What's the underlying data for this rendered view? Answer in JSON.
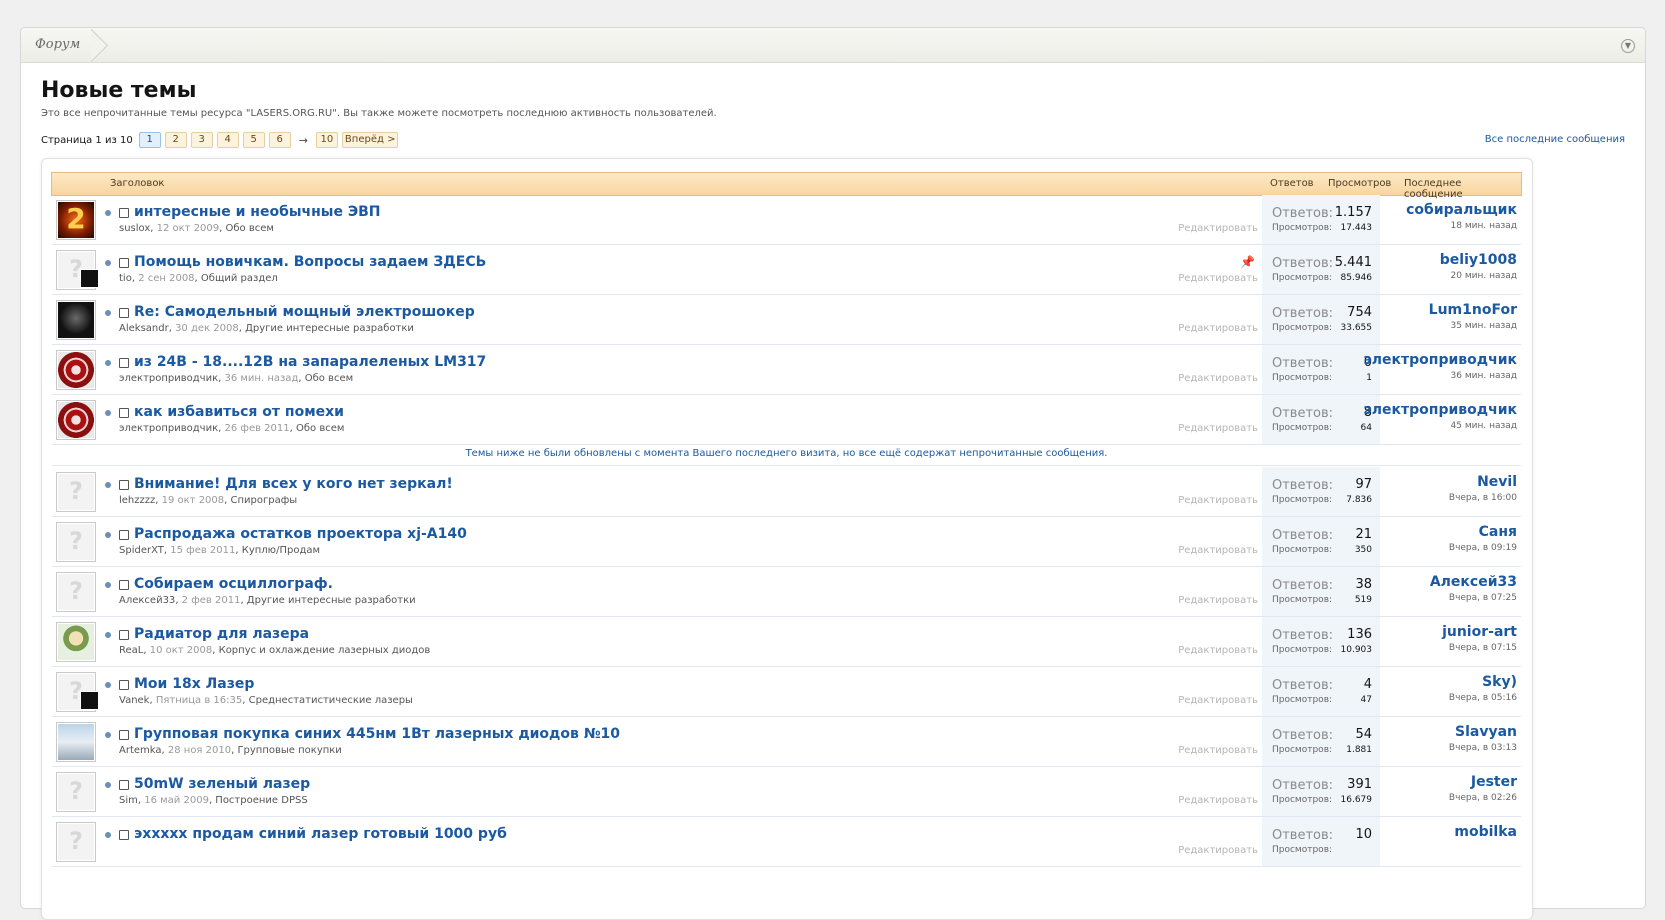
{
  "breadcrumb": {
    "root": "Форум"
  },
  "page": {
    "title": "Новые темы",
    "description": "Это все непрочитанные темы ресурса \"LASERS.ORG.RU\". Вы также можете посмотреть последнюю активность пользователей."
  },
  "pager": {
    "label": "Страница 1 из 10",
    "pages": [
      "1",
      "2",
      "3",
      "4",
      "5",
      "6"
    ],
    "arrow": "→",
    "last": "10",
    "next": "Вперёд >"
  },
  "all_recent": "Все последние сообщения",
  "table_head": {
    "title": "Заголовок",
    "replies": "Ответов",
    "views": "Просмотров",
    "last": "Последнее сообщение"
  },
  "labels": {
    "replies": "Ответов:",
    "views": "Просмотров:",
    "edit": "Редактировать",
    "pin": "📌"
  },
  "notice": "Темы ниже не были обновлены с момента Вашего последнего визита, но все ещё содержат непрочитанные сообщения.",
  "threads": [
    {
      "title": "интересные и необычные ЭВП",
      "author": "suslox",
      "date": "12 окт 2009",
      "forum": "Обо всем",
      "replies": "1.157",
      "views": "17.443",
      "last_user": "собиральщик",
      "last_time": "18 мин. назад",
      "avatar": "nixie"
    },
    {
      "title": "Помощь новичкам. Вопросы задаем ЗДЕСЬ",
      "author": "tio",
      "date": "2 сен 2008",
      "forum": "Общий раздел",
      "replies": "5.441",
      "views": "85.946",
      "last_user": "beliy1008",
      "last_time": "20 мин. назад",
      "avatar": "blank",
      "sticky": true,
      "mini": true
    },
    {
      "title": "Re: Самодельный мощный электрошокер",
      "author": "Aleksandr",
      "date": "30 дек 2008",
      "forum": "Другие интересные разработки",
      "replies": "754",
      "views": "33.655",
      "last_user": "Lum1noFor",
      "last_time": "35 мин. назад",
      "avatar": "face"
    },
    {
      "title": "из 24В - 18....12В на запаралеленых LM317",
      "author": "электроприводчик",
      "date": "36 мин. назад",
      "forum": "Обо всем",
      "replies": "0",
      "views": "1",
      "last_user": "электроприводчик",
      "last_time": "36 мин. назад",
      "avatar": "red"
    },
    {
      "title": "как избавиться от помехи",
      "author": "электроприводчик",
      "date": "26 фев 2011",
      "forum": "Обо всем",
      "replies": "8",
      "views": "64",
      "last_user": "электроприводчик",
      "last_time": "45 мин. назад",
      "avatar": "red"
    },
    {
      "title": "Внимание! Для всех у кого нет зеркал!",
      "author": "lehzzzz",
      "date": "19 окт 2008",
      "forum": "Спирографы",
      "replies": "97",
      "views": "7.836",
      "last_user": "Nevil",
      "last_time": "Вчера, в 16:00",
      "avatar": "blank"
    },
    {
      "title": "Распродажа остатков проектора xj-A140",
      "author": "SpiderXT",
      "date": "15 фев 2011",
      "forum": "Куплю/Продам",
      "replies": "21",
      "views": "350",
      "last_user": "Саня",
      "last_time": "Вчера, в 09:19",
      "avatar": "blank"
    },
    {
      "title": "Собираем осциллограф.",
      "author": "Алексей33",
      "date": "2 фев 2011",
      "forum": "Другие интересные разработки",
      "replies": "38",
      "views": "519",
      "last_user": "Алексей33",
      "last_time": "Вчера, в 07:25",
      "avatar": "blank"
    },
    {
      "title": "Радиатор для лазера",
      "author": "ReaL",
      "date": "10 окт 2008",
      "forum": "Корпус и охлаждение лазерных диодов",
      "replies": "136",
      "views": "10.903",
      "last_user": "junior-art",
      "last_time": "Вчера, в 07:15",
      "avatar": "cartoon"
    },
    {
      "title": "Мои 18х Лазер",
      "author": "Vanek",
      "date": "Пятница в 16:35",
      "forum": "Среднестатистические лазеры",
      "replies": "4",
      "views": "47",
      "last_user": "Sky)",
      "last_time": "Вчера, в 05:16",
      "avatar": "blank",
      "mini": true
    },
    {
      "title": "Групповая покупка синих 445нм 1Вт лазерных диодов №10",
      "author": "Artemka",
      "date": "28 ноя 2010",
      "forum": "Групповые покупки",
      "replies": "54",
      "views": "1.881",
      "last_user": "Slavyan",
      "last_time": "Вчера, в 03:13",
      "avatar": "photo"
    },
    {
      "title": "50mW зеленый лазер",
      "author": "Sim",
      "date": "16 май 2009",
      "forum": "Построение DPSS",
      "replies": "391",
      "views": "16.679",
      "last_user": "Jester",
      "last_time": "Вчера, в 02:26",
      "avatar": "blank"
    },
    {
      "title": "эххххх продам синий лазер готовый 1000 руб",
      "author": "",
      "date": "",
      "forum": "",
      "replies": "10",
      "views": "",
      "last_user": "mobilka",
      "last_time": "",
      "avatar": "blank"
    }
  ]
}
